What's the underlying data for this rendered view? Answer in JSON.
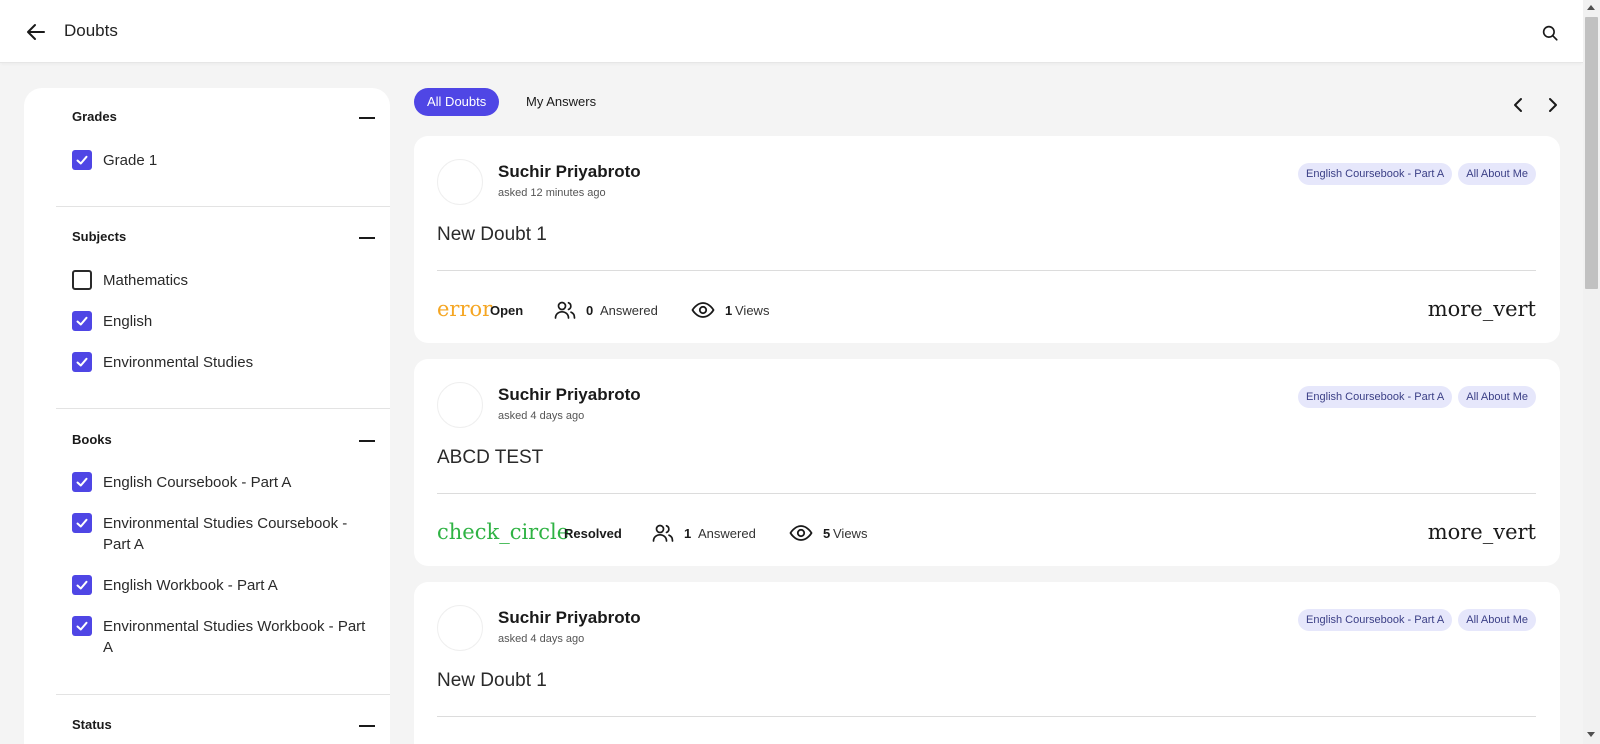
{
  "header": {
    "title": "Doubts"
  },
  "filters": {
    "grades": {
      "heading": "Grades",
      "items": [
        {
          "label": "Grade 1",
          "checked": true
        }
      ]
    },
    "subjects": {
      "heading": "Subjects",
      "items": [
        {
          "label": "Mathematics",
          "checked": false
        },
        {
          "label": "English",
          "checked": true
        },
        {
          "label": "Environmental Studies",
          "checked": true
        }
      ]
    },
    "books": {
      "heading": "Books",
      "items": [
        {
          "label": "English Coursebook - Part A",
          "checked": true
        },
        {
          "label": "Environmental Studies Coursebook - Part A",
          "checked": true
        },
        {
          "label": "English Workbook - Part A",
          "checked": true
        },
        {
          "label": "Environmental Studies Workbook - Part A",
          "checked": true
        }
      ]
    },
    "status": {
      "heading": "Status"
    }
  },
  "tabs": [
    {
      "label": "All Doubts",
      "active": true
    },
    {
      "label": "My Answers",
      "active": false
    }
  ],
  "colors": {
    "accent": "#4f46e5",
    "open": "#f5a623",
    "resolved": "#2fb344",
    "tag_bg": "#e6e7fb"
  },
  "doubts": [
    {
      "author": "Suchir Priyabroto",
      "asked": "asked 12 minutes ago",
      "tags": [
        "English Coursebook - Part A",
        "All About Me"
      ],
      "question": "New Doubt 1",
      "status_icon": "error",
      "status": "Open",
      "answers": "0",
      "answers_label": "Answered",
      "views": "1",
      "views_label": "Views",
      "menu_icon": "more_vert"
    },
    {
      "author": "Suchir Priyabroto",
      "asked": "asked 4 days ago",
      "tags": [
        "English Coursebook - Part A",
        "All About Me"
      ],
      "question": "ABCD TEST",
      "status_icon": "check_circle",
      "status": "Resolved",
      "answers": "1",
      "answers_label": "Answered",
      "views": "5",
      "views_label": "Views",
      "menu_icon": "more_vert"
    },
    {
      "author": "Suchir Priyabroto",
      "asked": "asked 4 days ago",
      "tags": [
        "English Coursebook - Part A",
        "All About Me"
      ],
      "question": "New Doubt 1"
    }
  ]
}
